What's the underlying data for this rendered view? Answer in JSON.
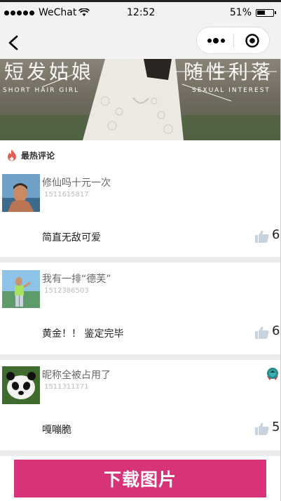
{
  "status_bar": {
    "carrier": "WeChat",
    "time": "12:52",
    "battery": "51%"
  },
  "banner": {
    "title_left": "短发姑娘",
    "title_right": "随性利落",
    "sub_left": "SHORT HAIR GIRL",
    "sub_right": "SEXUAL INTEREST"
  },
  "section": {
    "title": "最热评论"
  },
  "comments": [
    {
      "nick": "修仙吗十元一次",
      "uid": "1511615817",
      "text": "简直无敌可爱",
      "likes": "6"
    },
    {
      "nick": "我有一排“德芙”",
      "uid": "1512386503",
      "text": "黄金！！ 鉴定完毕",
      "likes": "6"
    },
    {
      "nick": "昵称全被占用了",
      "uid": "1511311171",
      "text": "嘎嘣脆",
      "likes": "5"
    }
  ],
  "actions": {
    "download": "下载图片"
  },
  "colors": {
    "accent": "#d63378",
    "divider": "#ececec"
  }
}
